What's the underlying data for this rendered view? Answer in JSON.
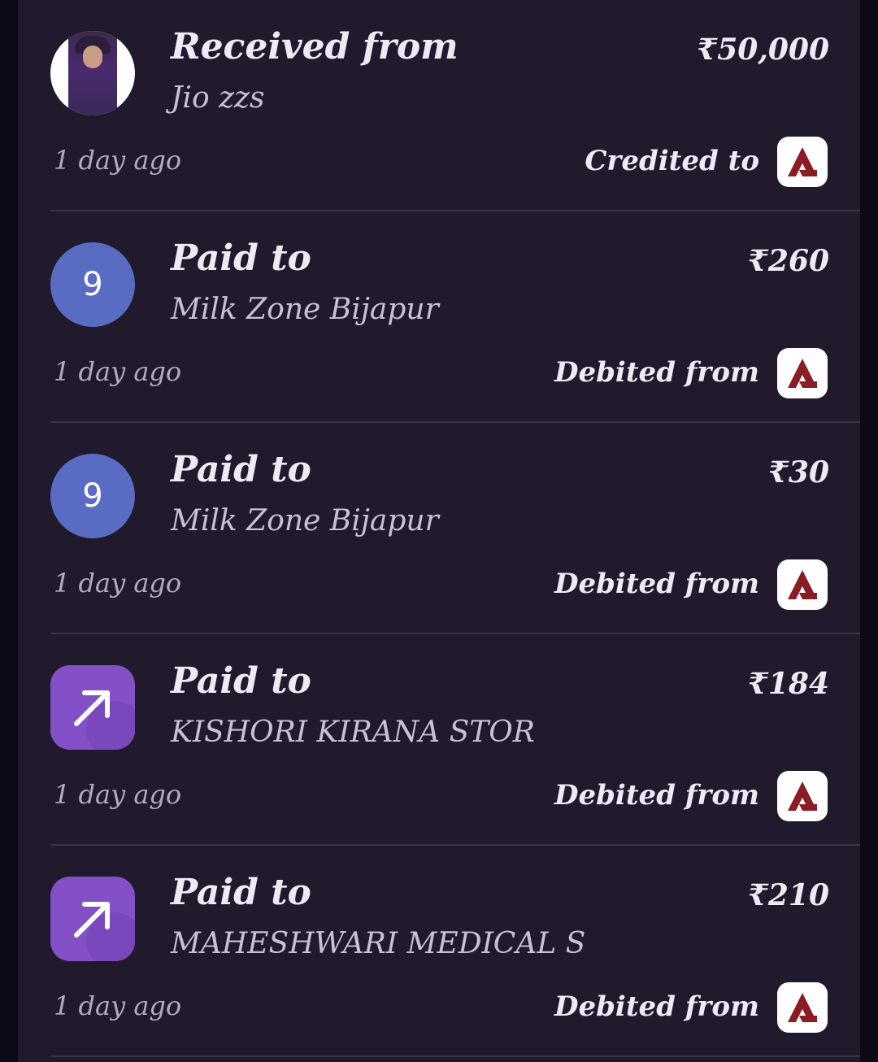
{
  "colors": {
    "background": "#211a2c",
    "divider": "#3a3346",
    "avatar_circle": "#5a6bc4",
    "avatar_square": "#8450c8",
    "bank_icon": "#8a1c24"
  },
  "transactions": [
    {
      "title": "Received from",
      "name": "Jio zzs",
      "amount": "₹50,000",
      "time": "1 day ago",
      "bank_label": "Credited to",
      "avatar": "profile-photo",
      "bank_icon": "axis-bank-icon"
    },
    {
      "title": "Paid to",
      "name": "Milk Zone Bijapur",
      "amount": "₹260",
      "time": "1 day ago",
      "bank_label": "Debited from",
      "avatar": "letter-circle",
      "avatar_letter": "9",
      "bank_icon": "axis-bank-icon"
    },
    {
      "title": "Paid to",
      "name": "Milk Zone Bijapur",
      "amount": "₹30",
      "time": "1 day ago",
      "bank_label": "Debited from",
      "avatar": "letter-circle",
      "avatar_letter": "9",
      "bank_icon": "axis-bank-icon"
    },
    {
      "title": "Paid to",
      "name": "KISHORI KIRANA STOR",
      "amount": "₹184",
      "time": "1 day ago",
      "bank_label": "Debited from",
      "avatar": "arrow-up-right-icon",
      "bank_icon": "axis-bank-icon"
    },
    {
      "title": "Paid to",
      "name": "MAHESHWARI MEDICAL S",
      "amount": "₹210",
      "time": "1 day ago",
      "bank_label": "Debited from",
      "avatar": "arrow-up-right-icon",
      "bank_icon": "axis-bank-icon"
    }
  ]
}
